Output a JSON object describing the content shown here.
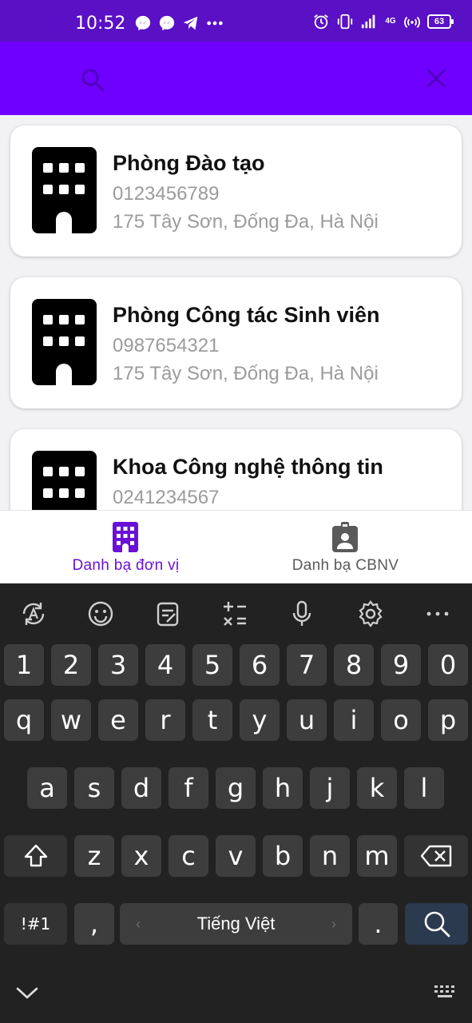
{
  "status_bar": {
    "time": "10:52",
    "left_icons": [
      "messenger-icon",
      "messenger-icon",
      "telegram-icon",
      "more-dots-icon"
    ],
    "right_icons": [
      "alarm-icon",
      "vibrate-icon",
      "signal-icon",
      "4g-icon",
      "hotspot-icon",
      "battery-icon"
    ],
    "network": "4G",
    "battery": "63"
  },
  "app_bar": {
    "background": "#6f00ff",
    "search_placeholder": "",
    "search_value": ""
  },
  "units": [
    {
      "name": "Phòng Đào tạo",
      "phone": "0123456789",
      "address": "175 Tây Sơn, Đống Đa, Hà Nội"
    },
    {
      "name": "Phòng Công tác Sinh viên",
      "phone": "0987654321",
      "address": "175 Tây Sơn, Đống Đa, Hà Nội"
    },
    {
      "name": "Khoa Công nghệ thông tin",
      "phone": "0241234567",
      "address": ""
    }
  ],
  "bottom_nav": {
    "items": [
      {
        "label": "Danh bạ đơn vị",
        "icon": "building-icon",
        "active": true
      },
      {
        "label": "Danh bạ CBNV",
        "icon": "badge-icon",
        "active": false
      }
    ],
    "active_color": "#6a10d8"
  },
  "keyboard": {
    "toolbar": [
      "auto-correct-icon",
      "emoji-icon",
      "clipboard-icon",
      "calculator-icon",
      "microphone-icon",
      "settings-icon",
      "more-icon"
    ],
    "row_numbers": [
      "1",
      "2",
      "3",
      "4",
      "5",
      "6",
      "7",
      "8",
      "9",
      "0"
    ],
    "row_1": [
      "q",
      "w",
      "e",
      "r",
      "t",
      "y",
      "u",
      "i",
      "o",
      "p"
    ],
    "row_2": [
      "a",
      "s",
      "d",
      "f",
      "g",
      "h",
      "j",
      "k",
      "l"
    ],
    "row_3": [
      "z",
      "x",
      "c",
      "v",
      "b",
      "n",
      "m"
    ],
    "symbols_key": "!#1",
    "comma_key": ",",
    "space_label": "Tiếng Việt",
    "period_key": "."
  }
}
